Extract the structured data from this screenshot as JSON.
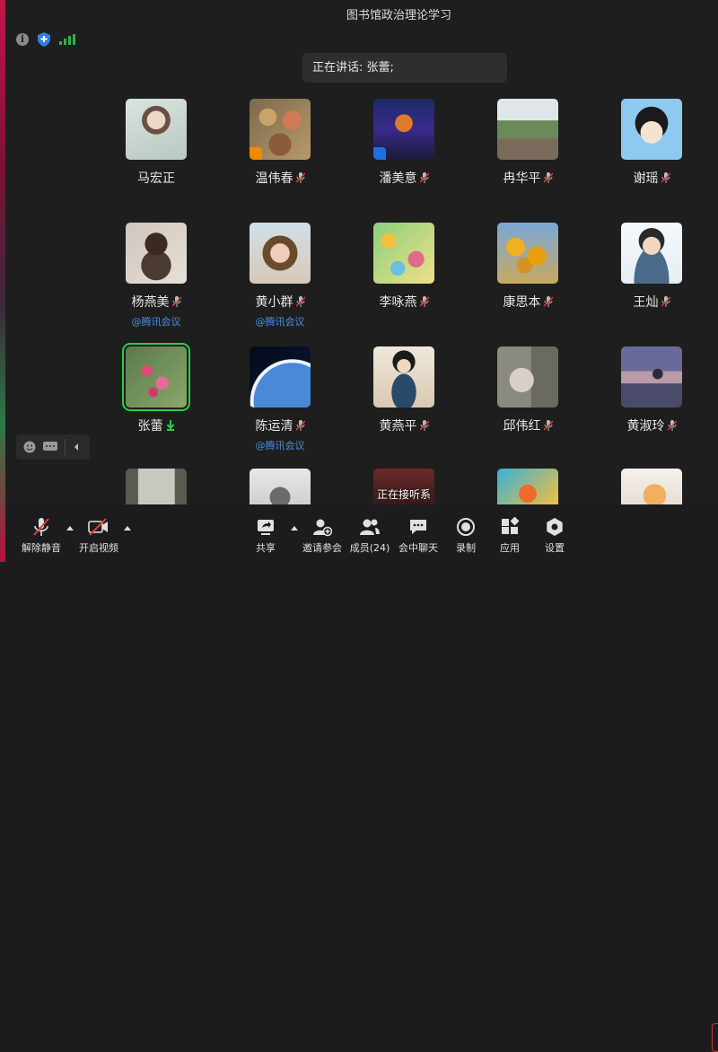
{
  "window": {
    "title": "图书馆政治理论学习"
  },
  "speaking": {
    "label": "正在讲话: 张蕾;"
  },
  "participants": [
    {
      "name": "马宏正",
      "muted": false,
      "sub": ""
    },
    {
      "name": "温伟春",
      "muted": true,
      "sub": "",
      "badge": "orange"
    },
    {
      "name": "潘美意",
      "muted": true,
      "sub": "",
      "badge": "blue"
    },
    {
      "name": "冉华平",
      "muted": true,
      "sub": ""
    },
    {
      "name": "谢瑶",
      "muted": true,
      "sub": ""
    },
    {
      "name": "杨燕美",
      "muted": true,
      "sub": "@腾讯会议"
    },
    {
      "name": "黄小群",
      "muted": true,
      "sub": "@腾讯会议"
    },
    {
      "name": "李咏燕",
      "muted": true,
      "sub": ""
    },
    {
      "name": "康思本",
      "muted": true,
      "sub": ""
    },
    {
      "name": "王灿",
      "muted": true,
      "sub": ""
    },
    {
      "name": "张蕾",
      "muted": false,
      "speaking": true,
      "sub": ""
    },
    {
      "name": "陈运清",
      "muted": true,
      "sub": "@腾讯会议"
    },
    {
      "name": "黄燕平",
      "muted": true,
      "sub": ""
    },
    {
      "name": "邱伟红",
      "muted": true,
      "sub": ""
    },
    {
      "name": "黄淑玲",
      "muted": true,
      "sub": ""
    }
  ],
  "partial_row": {
    "overlay_text": "正在接听系统电话"
  },
  "toolbar": {
    "unmute": "解除静音",
    "start_video": "开启视频",
    "share": "共享",
    "invite": "邀请参会",
    "members": "成员(24)",
    "chat": "会中聊天",
    "record": "录制",
    "apps": "应用",
    "settings": "设置"
  },
  "colors": {
    "accent": "#2ecc4a",
    "link": "#4a8fe7",
    "background": "#1e1e1e"
  }
}
